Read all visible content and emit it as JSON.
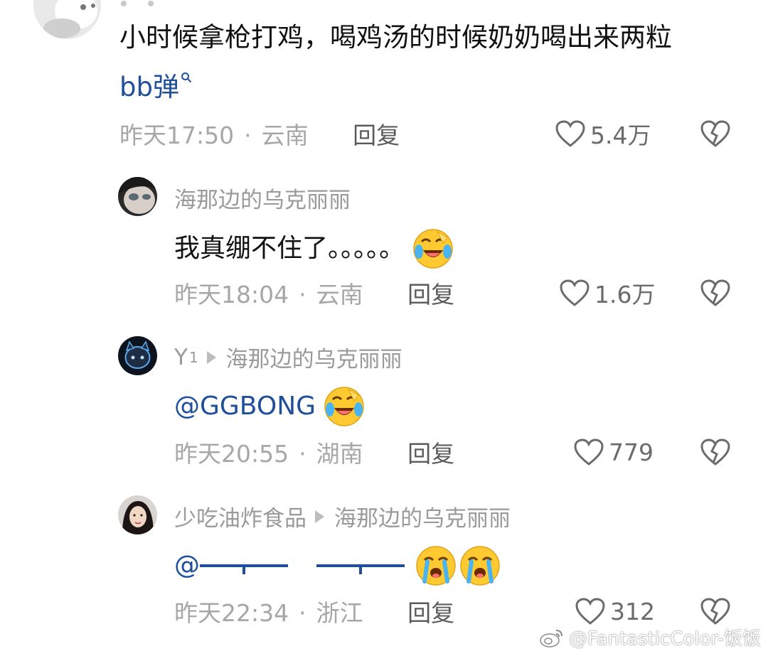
{
  "top_comment": {
    "avatar": "cat-avatar",
    "text_line1": "小时候拿枪打鸡，喝鸡汤的时候奶奶喝出来两粒",
    "search_term": "bb弹",
    "time": "昨天17:50",
    "location": "云南",
    "reply_label": "回复",
    "likes": "5.4万"
  },
  "replies": [
    {
      "name": "海那边的乌克丽丽",
      "text": "我真绷不住了。。。。。",
      "emoji": "laughing-crying-emoji",
      "time": "昨天18:04",
      "location": "云南",
      "reply_label": "回复",
      "likes": "1.6万"
    },
    {
      "name": "Y",
      "name_sup": "1",
      "reply_to": "海那边的乌克丽丽",
      "mention": "@GGBONG",
      "emoji": "laughing-crying-emoji",
      "time": "昨天20:55",
      "location": "湖南",
      "reply_label": "回复",
      "likes": "779"
    },
    {
      "name": "少吃油炸食品",
      "reply_to": "海那边的乌克丽丽",
      "mention": "@",
      "emoji": "crying-emoji",
      "time": "昨天22:34",
      "location": "浙江",
      "reply_label": "回复",
      "likes": "312"
    }
  ],
  "meta_separator": "·",
  "watermark": "@FantasticColor-饭饭",
  "colors": {
    "link": "#1f4f9c",
    "meta": "#a7a7a7",
    "reply": "#5b5b5b"
  }
}
